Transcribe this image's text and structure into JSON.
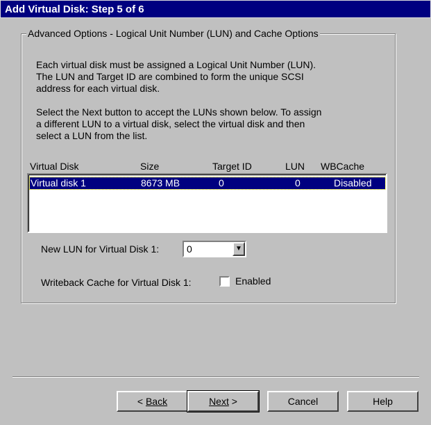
{
  "window": {
    "title": "Add Virtual Disk: Step 5 of 6"
  },
  "group": {
    "legend": "Advanced Options - Logical Unit Number (LUN) and Cache Options"
  },
  "intro": {
    "p1": "Each virtual disk must be assigned a Logical Unit Number (LUN).  The LUN and Target ID are combined to form the unique SCSI address for each virtual disk.",
    "p2": "Select the Next button to accept the LUNs shown below.  To assign a different LUN to a virtual disk, select the virtual disk and then select a LUN from the list."
  },
  "table": {
    "columns": [
      "Virtual Disk",
      "Size",
      "Target ID",
      "LUN",
      "WBCache"
    ],
    "rows": [
      [
        "Virtual disk 1",
        "8673 MB",
        "0",
        "0",
        "Disabled"
      ]
    ]
  },
  "lun": {
    "label": "New LUN for Virtual Disk 1:",
    "value": "0"
  },
  "cache": {
    "label": "Writeback Cache for Virtual Disk 1:",
    "checkbox_label": "Enabled",
    "checked": false
  },
  "buttons": {
    "back": "Back",
    "next": "Next",
    "next_arrow": " >",
    "back_arrow": "< ",
    "cancel": "Cancel",
    "help": "Help"
  }
}
